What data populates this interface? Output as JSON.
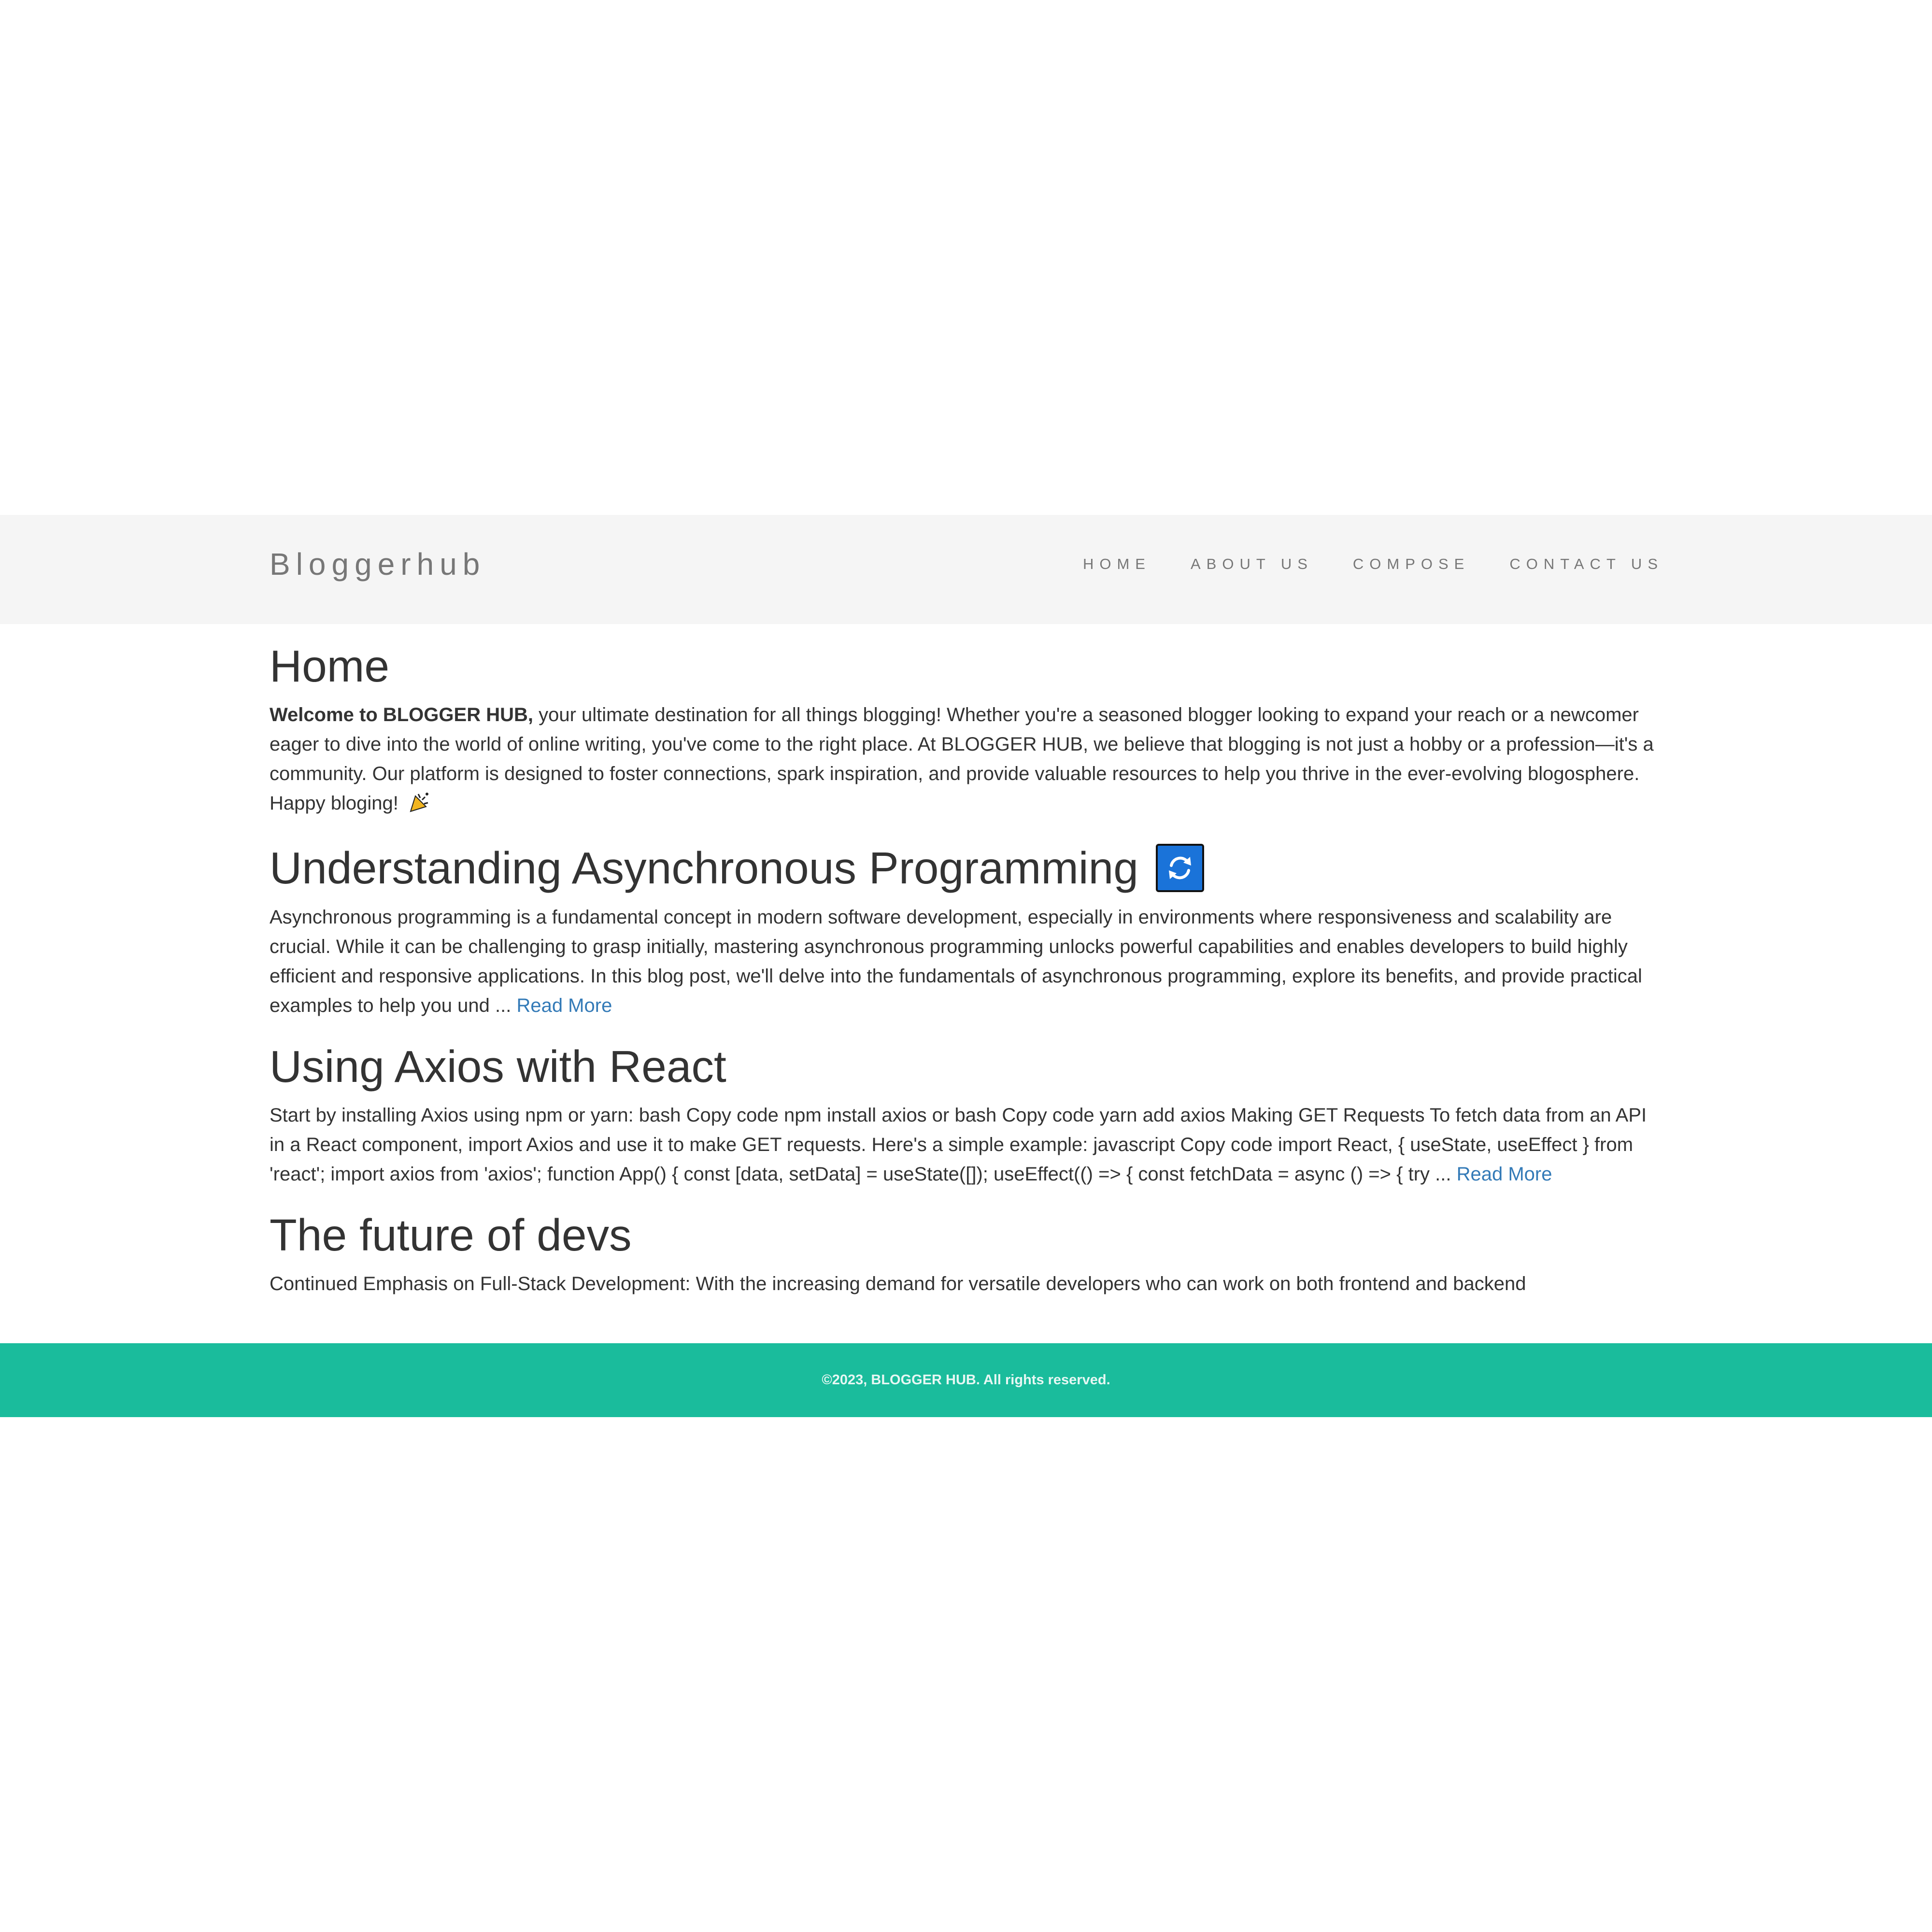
{
  "brand": "Bloggerhub",
  "nav": {
    "items": [
      {
        "label": "HOME"
      },
      {
        "label": "ABOUT US"
      },
      {
        "label": "COMPOSE"
      },
      {
        "label": "CONTACT US"
      }
    ]
  },
  "home": {
    "title": "Home",
    "intro_bold": "Welcome to BLOGGER HUB,",
    "intro_text": " your ultimate destination for all things blogging! Whether you're a seasoned blogger looking to expand your reach or a newcomer eager to dive into the world of online writing, you've come to the right place. At BLOGGER HUB, we believe that blogging is not just a hobby or a profession—it's a community. Our platform is designed to foster connections, spark inspiration, and provide valuable resources to help you thrive in the ever-evolving blogosphere. Happy bloging! "
  },
  "posts": [
    {
      "title": "Understanding Asynchronous Programming",
      "excerpt": "Asynchronous programming is a fundamental concept in modern software development, especially in environments where responsiveness and scalability are crucial. While it can be challenging to grasp initially, mastering asynchronous programming unlocks powerful capabilities and enables developers to build highly efficient and responsive applications. In this blog post, we'll delve into the fundamentals of asynchronous programming, explore its benefits, and provide practical examples to help you und ... ",
      "read_more": "Read More",
      "icon": "sync-icon"
    },
    {
      "title": "Using Axios with React",
      "excerpt": "Start by installing Axios using npm or yarn: bash Copy code npm install axios or bash Copy code yarn add axios Making GET Requests To fetch data from an API in a React component, import Axios and use it to make GET requests. Here's a simple example: javascript Copy code import React, { useState, useEffect } from 'react'; import axios from 'axios'; function App() { const [data, setData] = useState([]); useEffect(() => { const fetchData = async () => { try ... ",
      "read_more": "Read More"
    },
    {
      "title": "The future of devs",
      "excerpt": "Continued Emphasis on Full-Stack Development: With the increasing demand for versatile developers who can work on both frontend and backend"
    }
  ],
  "footer": {
    "text": "©2023, BLOGGER HUB. All rights reserved."
  },
  "colors": {
    "navbar_bg": "#f5f5f5",
    "footer_bg": "#1abc9c",
    "link": "#337ab7",
    "icon_bg": "#1a73d9"
  }
}
